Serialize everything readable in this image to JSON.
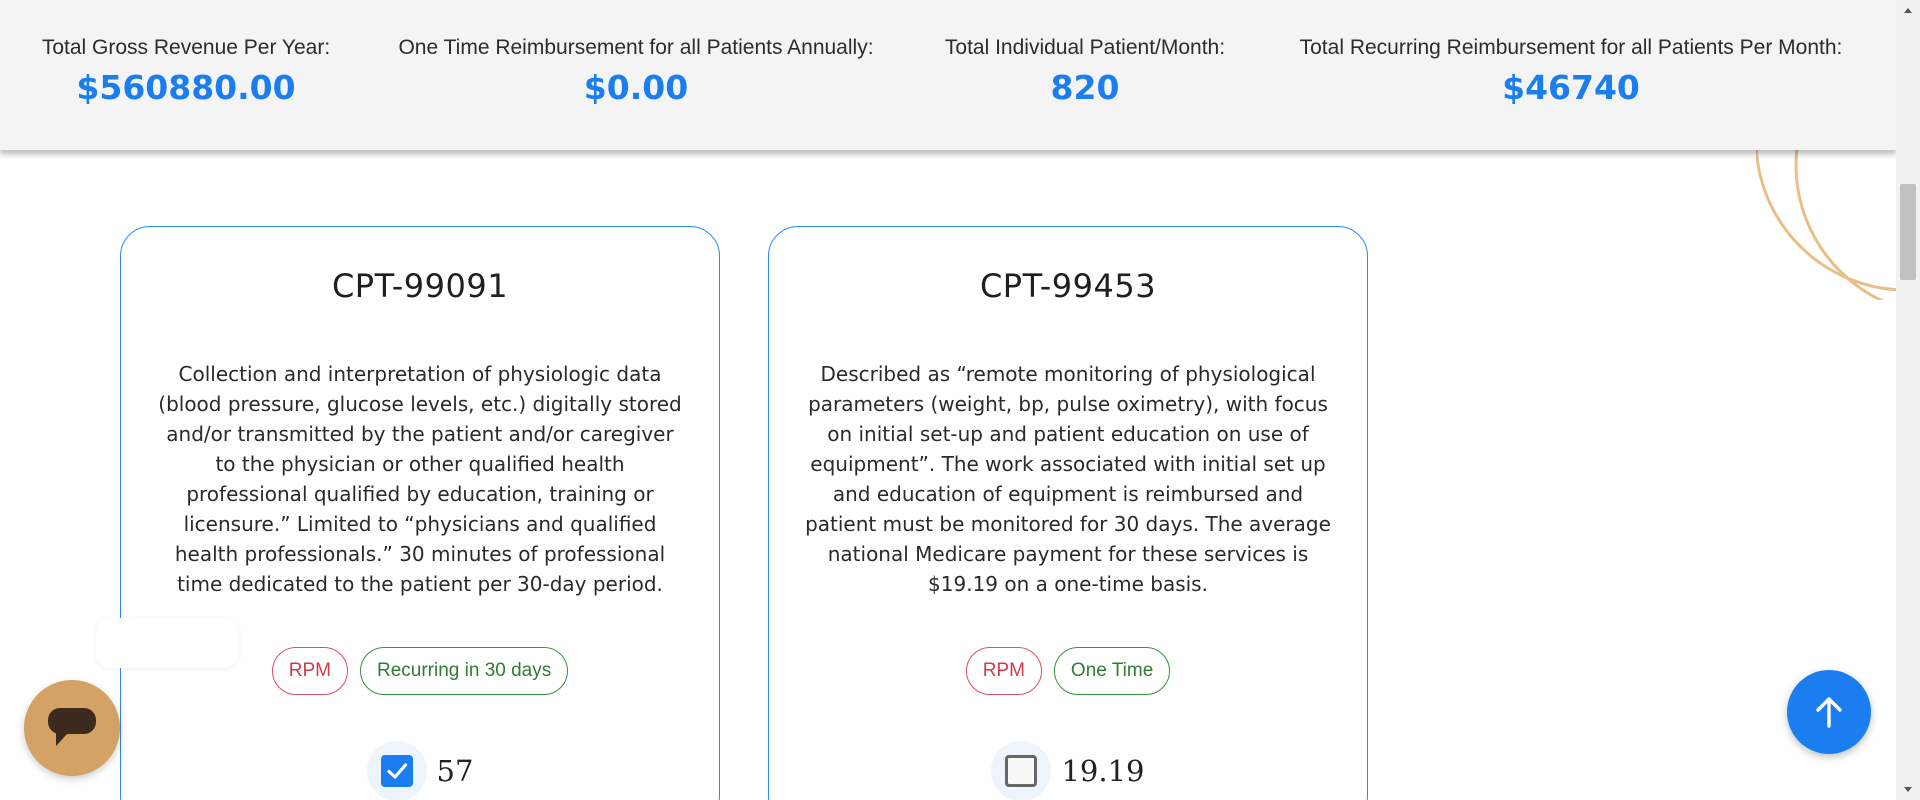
{
  "summary": {
    "stats": [
      {
        "label": "Total Gross Revenue Per Year:",
        "value": "$560880.00"
      },
      {
        "label": "One Time Reimbursement for all Patients Annually:",
        "value": "$0.00"
      },
      {
        "label": "Total Individual Patient/Month:",
        "value": "820"
      },
      {
        "label": "Total Recurring Reimbursement for all Patients Per Month:",
        "value": "$46740"
      }
    ]
  },
  "cards": [
    {
      "title": "CPT-99091",
      "description": "Collection and interpretation of physiologic data (blood pressure, glucose levels, etc.) digitally stored and/or transmitted by the patient and/or caregiver to the physician or other qualified health professional qualified by education, training or licensure.” Limited to “physicians and qualified health professionals.” 30 minutes of professional time dedicated to the patient per 30-day period.",
      "tags": [
        "RPM",
        "Recurring in 30 days"
      ],
      "checked": true,
      "price": "57"
    },
    {
      "title": "CPT-99453",
      "description": "Described as “remote monitoring of physiological parameters (weight, bp, pulse oximetry), with focus on initial set-up and patient education on use of equipment”. The work associated with initial set up and education of equipment is reimbursed and patient must be monitored for 30 days. The average national Medicare payment for these services is $19.19 on a one-time basis.",
      "tags": [
        "RPM",
        "One Time"
      ],
      "checked": false,
      "price": "19.19"
    }
  ],
  "icons": {
    "chat": "chat-icon",
    "scroll_top": "arrow-up-icon",
    "check": "checkmark-icon"
  },
  "colors": {
    "accent": "#1b7ef0",
    "rpm_tag": "#d03a4a",
    "frequency_tag": "#2e7d32",
    "chat_button": "#d5a265",
    "decoration": "#eabf86"
  }
}
